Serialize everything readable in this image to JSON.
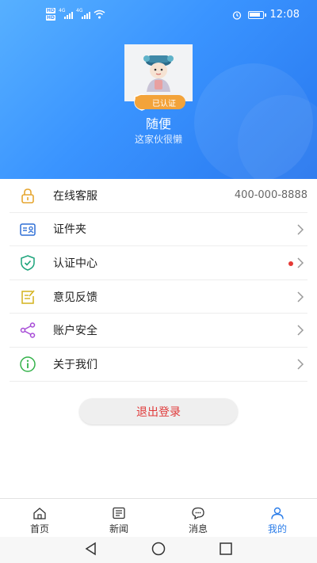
{
  "status_bar": {
    "hd1": "HD",
    "hd2": "HD",
    "net1": "4G",
    "net2": "4G",
    "time": "12:08"
  },
  "profile": {
    "name": "随便",
    "motto": "这家伙很懒",
    "badge": "已认证"
  },
  "menu": [
    {
      "label": "在线客服",
      "value": "400-000-8888",
      "icon": "lock-icon"
    },
    {
      "label": "证件夹",
      "icon": "id-card-icon"
    },
    {
      "label": "认证中心",
      "icon": "shield-check-icon",
      "has_dot": true
    },
    {
      "label": "意见反馈",
      "icon": "edit-feedback-icon"
    },
    {
      "label": "账户安全",
      "icon": "share-icon"
    },
    {
      "label": "关于我们",
      "icon": "info-icon"
    }
  ],
  "logout_label": "退出登录",
  "tabs": [
    {
      "label": "首页",
      "icon": "home-icon"
    },
    {
      "label": "新闻",
      "icon": "news-icon"
    },
    {
      "label": "消息",
      "icon": "message-icon"
    },
    {
      "label": "我的",
      "icon": "user-icon",
      "active": true
    }
  ],
  "colors": {
    "header_blue": "#3a94ff",
    "accent": "#2b7de9",
    "logout_red": "#e03a3a",
    "badge_orange": "#f3a33a",
    "notification_dot": "#e53935"
  }
}
